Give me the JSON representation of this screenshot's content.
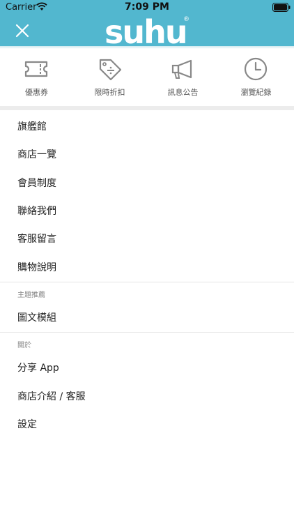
{
  "status_bar": {
    "carrier": "Carrier",
    "time": "7:09 PM"
  },
  "header": {
    "brand": "suhu",
    "trademark": "®",
    "accent_color": "#52b7cf"
  },
  "quick_actions": [
    {
      "label": "優惠券",
      "icon": "ticket-icon"
    },
    {
      "label": "限時折扣",
      "icon": "discount-tag-icon"
    },
    {
      "label": "訊息公告",
      "icon": "megaphone-icon"
    },
    {
      "label": "瀏覽紀錄",
      "icon": "clock-icon"
    }
  ],
  "menu": {
    "main_items": [
      "旗艦館",
      "商店一覽",
      "會員制度",
      "聯絡我們",
      "客服留言",
      "購物說明"
    ],
    "section_theme": {
      "title": "主題推薦",
      "items": [
        "圖文模組"
      ]
    },
    "section_about": {
      "title": "關於",
      "items": [
        "分享 App",
        "商店介紹 / 客服",
        "設定"
      ]
    }
  }
}
